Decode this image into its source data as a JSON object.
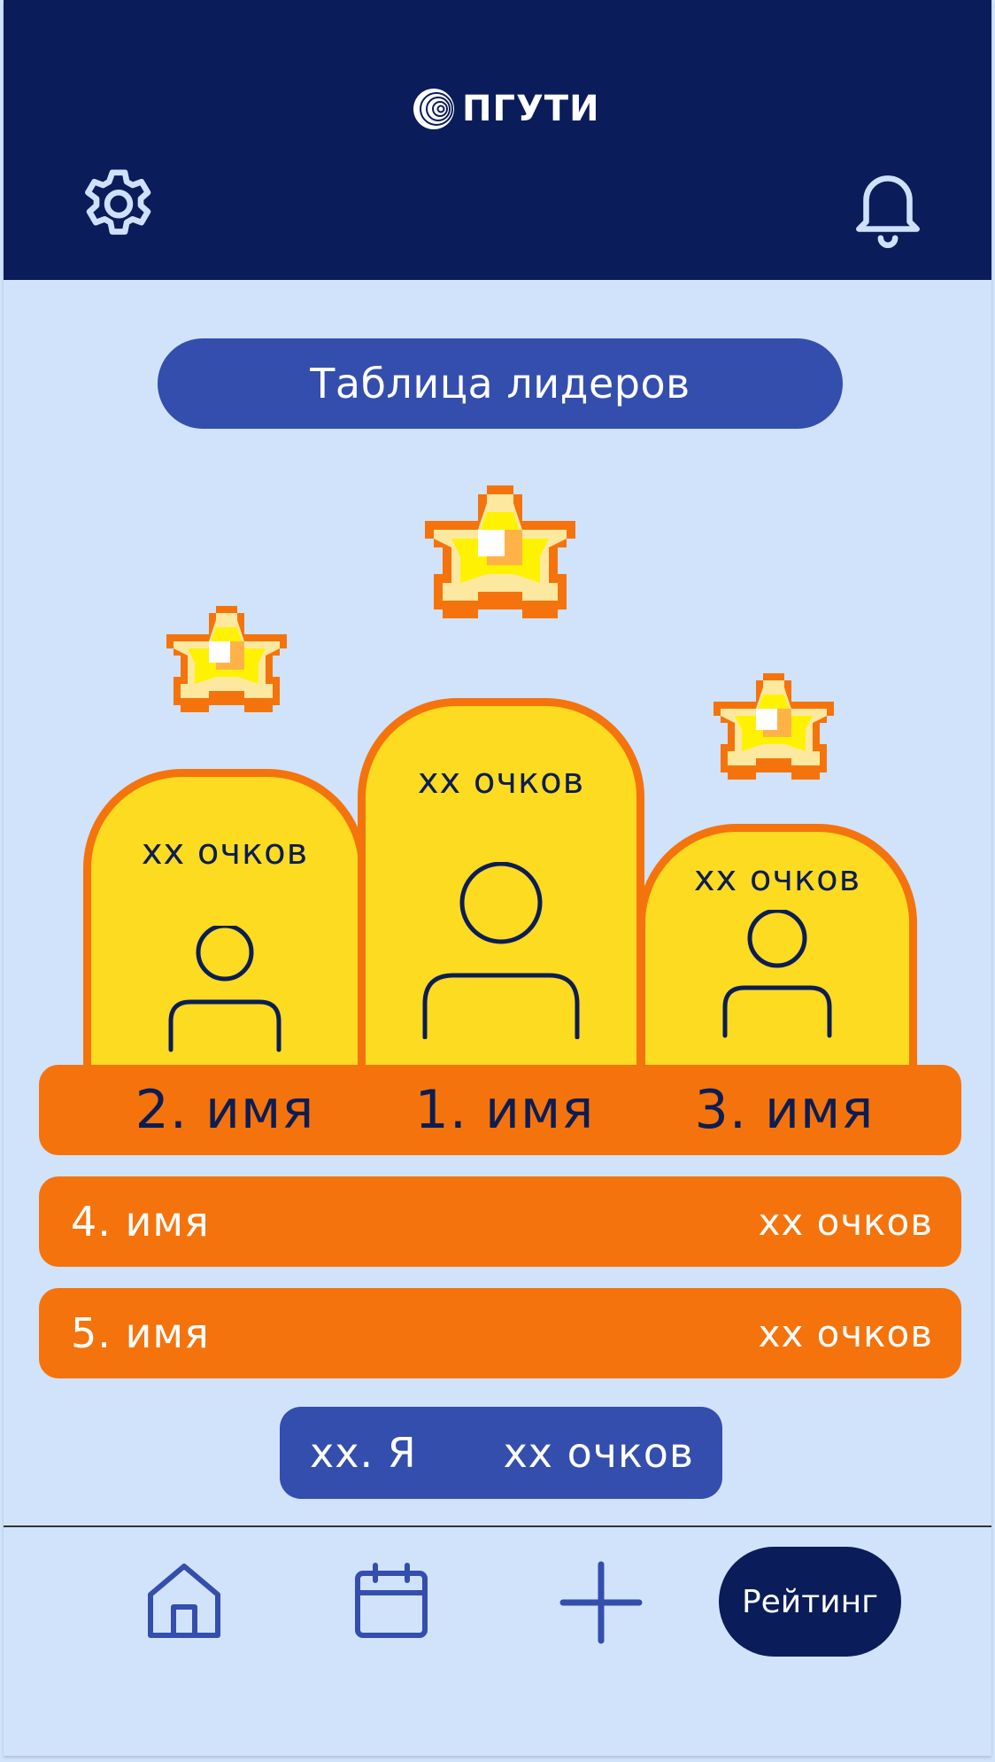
{
  "header": {
    "logo_text": "ПГУТИ",
    "settings_icon": "gear-icon",
    "notifications_icon": "bell-icon",
    "background": "#0a1c59"
  },
  "leaderboard": {
    "title": "Таблица лидеров",
    "podium": [
      {
        "place": "2. имя",
        "score": "xx очков"
      },
      {
        "place": "1. имя",
        "score": "xx очков"
      },
      {
        "place": "3. имя",
        "score": "xx очков"
      }
    ],
    "rows": [
      {
        "name": "4. имя",
        "score": "xx очков"
      },
      {
        "name": "5. имя",
        "score": "xx очков"
      }
    ],
    "me": {
      "name": "xx. Я",
      "score": "xx очков"
    }
  },
  "nav": {
    "items": [
      {
        "icon": "home-icon"
      },
      {
        "icon": "calendar-icon"
      },
      {
        "icon": "plus-icon"
      }
    ],
    "active_label": "Рейтинг"
  },
  "colors": {
    "background": "#d0e3fb",
    "accent_blue": "#344ead",
    "podium_yellow": "#fddb21",
    "podium_orange": "#f5730c",
    "dark_navy": "#0a1c59"
  }
}
